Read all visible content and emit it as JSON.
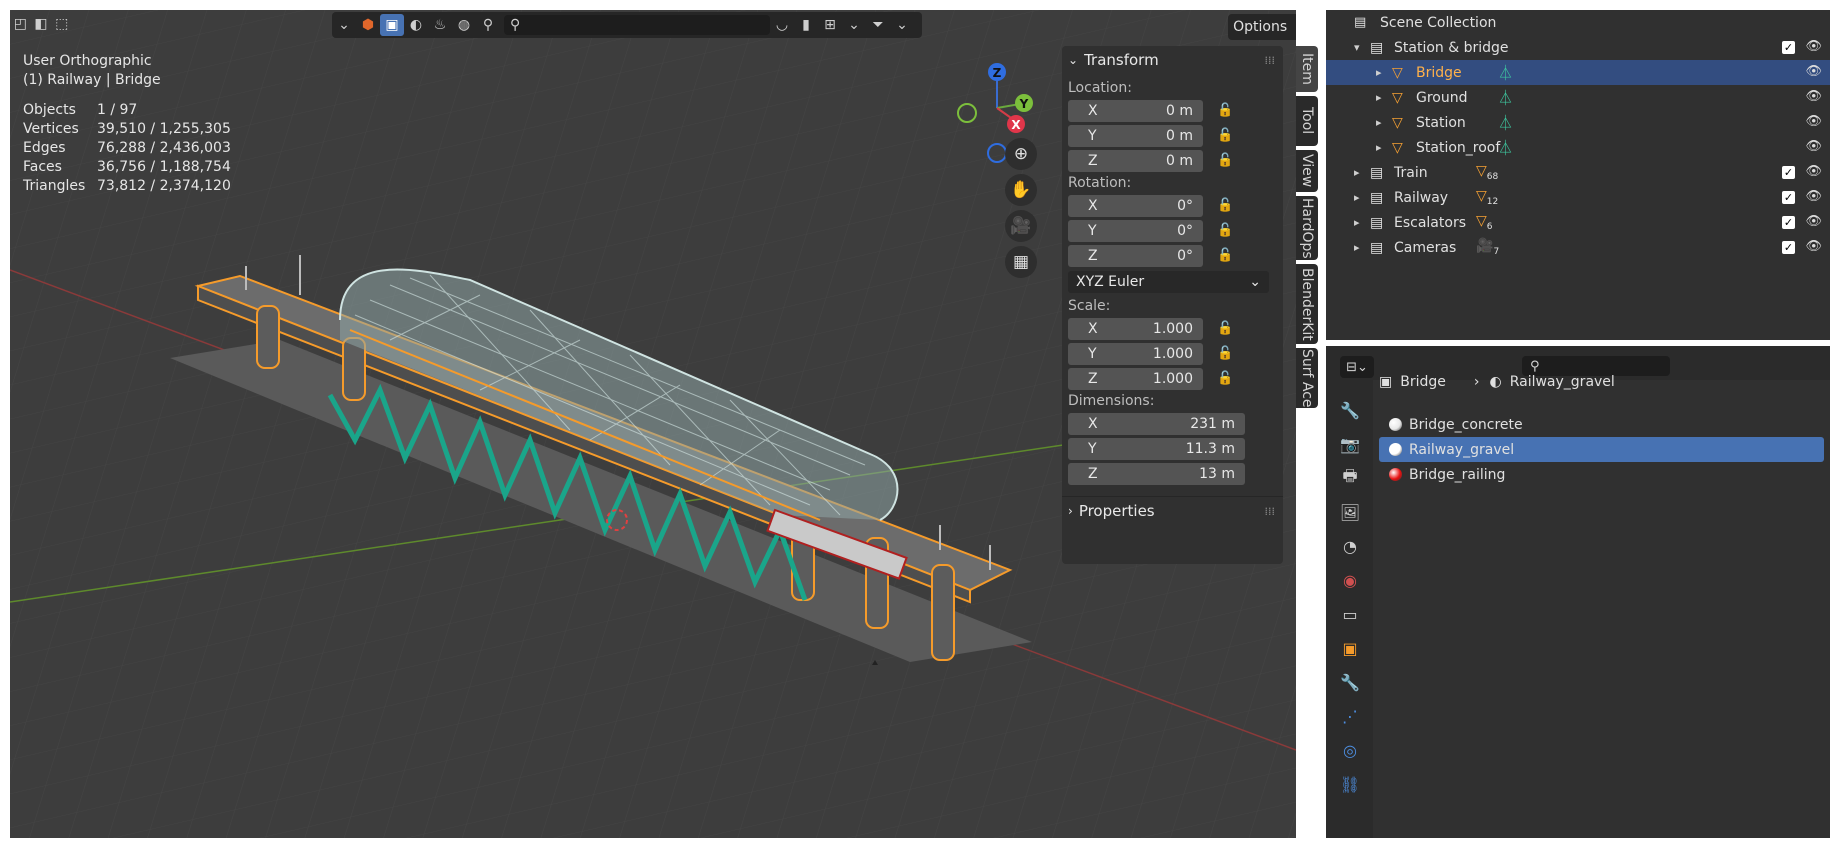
{
  "viewport": {
    "view_name": "User Orthographic",
    "context": "(1) Railway | Bridge",
    "stats": [
      {
        "k": "Objects",
        "v": "1 / 97"
      },
      {
        "k": "Vertices",
        "v": "39,510 / 1,255,305"
      },
      {
        "k": "Edges",
        "v": "76,288 / 2,436,003"
      },
      {
        "k": "Faces",
        "v": "36,756 / 1,188,754"
      },
      {
        "k": "Triangles",
        "v": "73,812 / 2,374,120"
      }
    ],
    "options_label": "Options",
    "gizmo": {
      "z": "Z",
      "y": "Y",
      "x": "X"
    }
  },
  "npanel": {
    "transform_title": "Transform",
    "location_label": "Location:",
    "location": [
      {
        "axis": "X",
        "value": "0 m"
      },
      {
        "axis": "Y",
        "value": "0 m"
      },
      {
        "axis": "Z",
        "value": "0 m"
      }
    ],
    "rotation_label": "Rotation:",
    "rotation": [
      {
        "axis": "X",
        "value": "0°"
      },
      {
        "axis": "Y",
        "value": "0°"
      },
      {
        "axis": "Z",
        "value": "0°"
      }
    ],
    "rotation_mode": "XYZ Euler",
    "scale_label": "Scale:",
    "scale": [
      {
        "axis": "X",
        "value": "1.000"
      },
      {
        "axis": "Y",
        "value": "1.000"
      },
      {
        "axis": "Z",
        "value": "1.000"
      }
    ],
    "dimensions_label": "Dimensions:",
    "dimensions": [
      {
        "axis": "X",
        "value": "231 m"
      },
      {
        "axis": "Y",
        "value": "11.3 m"
      },
      {
        "axis": "Z",
        "value": "13 m"
      }
    ],
    "properties_title": "Properties"
  },
  "vtabs": [
    "Item",
    "Tool",
    "View",
    "HardOps",
    "BlenderKit",
    "Surf Ace"
  ],
  "outliner": {
    "root": "Scene Collection",
    "rows": [
      {
        "label": "Station & bridge",
        "kind": "collection"
      },
      {
        "label": "Bridge",
        "kind": "mesh",
        "selected": true
      },
      {
        "label": "Ground",
        "kind": "mesh"
      },
      {
        "label": "Station",
        "kind": "mesh"
      },
      {
        "label": "Station_roof",
        "kind": "mesh"
      },
      {
        "label": "Train",
        "kind": "collection",
        "badge": "68"
      },
      {
        "label": "Railway",
        "kind": "collection",
        "badge": "12"
      },
      {
        "label": "Escalators",
        "kind": "collection",
        "badge": "6"
      },
      {
        "label": "Cameras",
        "kind": "collection",
        "badge": "7"
      }
    ]
  },
  "properties": {
    "breadcrumb_object": "Bridge",
    "breadcrumb_material": "Railway_gravel",
    "materials": [
      {
        "name": "Bridge_concrete",
        "color": "#e8e8e8"
      },
      {
        "name": "Railway_gravel",
        "color": "#ffffff",
        "selected": true
      },
      {
        "name": "Bridge_railing",
        "color": "#e81010"
      }
    ]
  },
  "colors": {
    "accent": "#4772b3",
    "selected_orange": "#f5a033",
    "mesh_icon_green": "#3ec8a0",
    "selection_outline": "#f59b2b",
    "spring_teal": "#1aa58a"
  }
}
